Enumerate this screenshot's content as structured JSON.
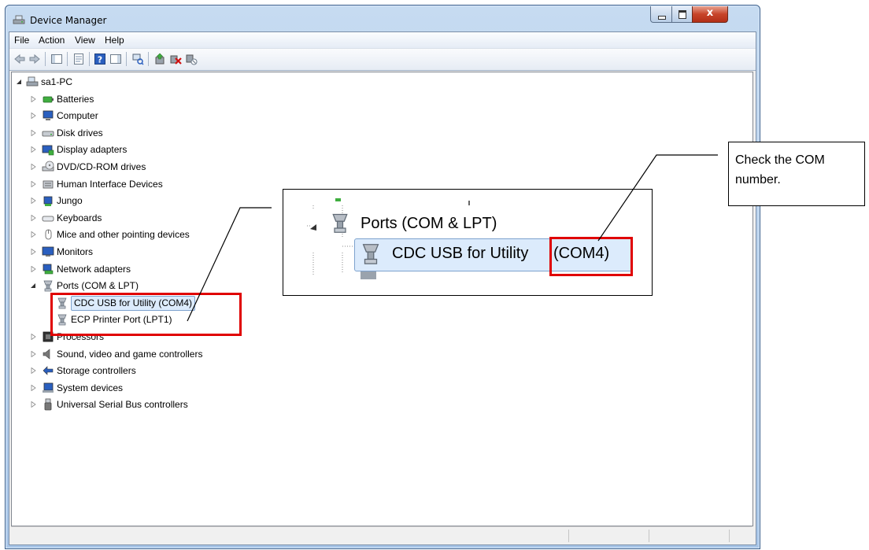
{
  "window": {
    "title": "Device Manager",
    "controls": {
      "minimize": "minimize",
      "maximize": "maximize",
      "close": "x"
    }
  },
  "menu": [
    "File",
    "Action",
    "View",
    "Help"
  ],
  "toolbar": [
    "back-arrow-icon",
    "forward-arrow-icon",
    "show-hide-console-tree-icon",
    "properties-icon",
    "help-icon",
    "action-pane-icon",
    "scan-hardware-changes-icon",
    "update-driver-icon",
    "uninstall-device-icon",
    "disable-device-icon"
  ],
  "tree": {
    "root": "sa1-PC",
    "items": [
      {
        "label": "Batteries",
        "icon": "battery-icon",
        "expanded": false
      },
      {
        "label": "Computer",
        "icon": "computer-icon",
        "expanded": false
      },
      {
        "label": "Disk drives",
        "icon": "disk-drive-icon",
        "expanded": false
      },
      {
        "label": "Display adapters",
        "icon": "display-adapter-icon",
        "expanded": false
      },
      {
        "label": "DVD/CD-ROM drives",
        "icon": "dvd-drive-icon",
        "expanded": false
      },
      {
        "label": "Human Interface Devices",
        "icon": "hid-icon",
        "expanded": false
      },
      {
        "label": "Jungo",
        "icon": "device-icon",
        "expanded": false
      },
      {
        "label": "Keyboards",
        "icon": "keyboard-icon",
        "expanded": false
      },
      {
        "label": "Mice and other pointing devices",
        "icon": "mouse-icon",
        "expanded": false
      },
      {
        "label": "Monitors",
        "icon": "monitor-icon",
        "expanded": false
      },
      {
        "label": "Network adapters",
        "icon": "network-adapter-icon",
        "expanded": false
      },
      {
        "label": "Ports (COM & LPT)",
        "icon": "port-icon",
        "expanded": true
      },
      {
        "label": "CDC USB for Utility (COM4)",
        "icon": "port-icon",
        "child": true,
        "selected": true
      },
      {
        "label": "ECP Printer Port (LPT1)",
        "icon": "port-icon",
        "child": true
      },
      {
        "label": "Processors",
        "icon": "processor-icon",
        "expanded": false
      },
      {
        "label": "Sound, video and game controllers",
        "icon": "sound-icon",
        "expanded": false
      },
      {
        "label": "Storage controllers",
        "icon": "storage-icon",
        "expanded": false
      },
      {
        "label": "System devices",
        "icon": "system-icon",
        "expanded": false
      },
      {
        "label": "Universal Serial Bus controllers",
        "icon": "usb-icon",
        "expanded": false
      }
    ]
  },
  "zoom_callout": {
    "parent_label": "Ports (COM & LPT)",
    "child_label": "CDC USB for Utility",
    "com_label": "(COM4)"
  },
  "note": {
    "text": "Check the COM number."
  },
  "colors": {
    "highlight": "#e00000",
    "selection": "#dcebfc"
  }
}
